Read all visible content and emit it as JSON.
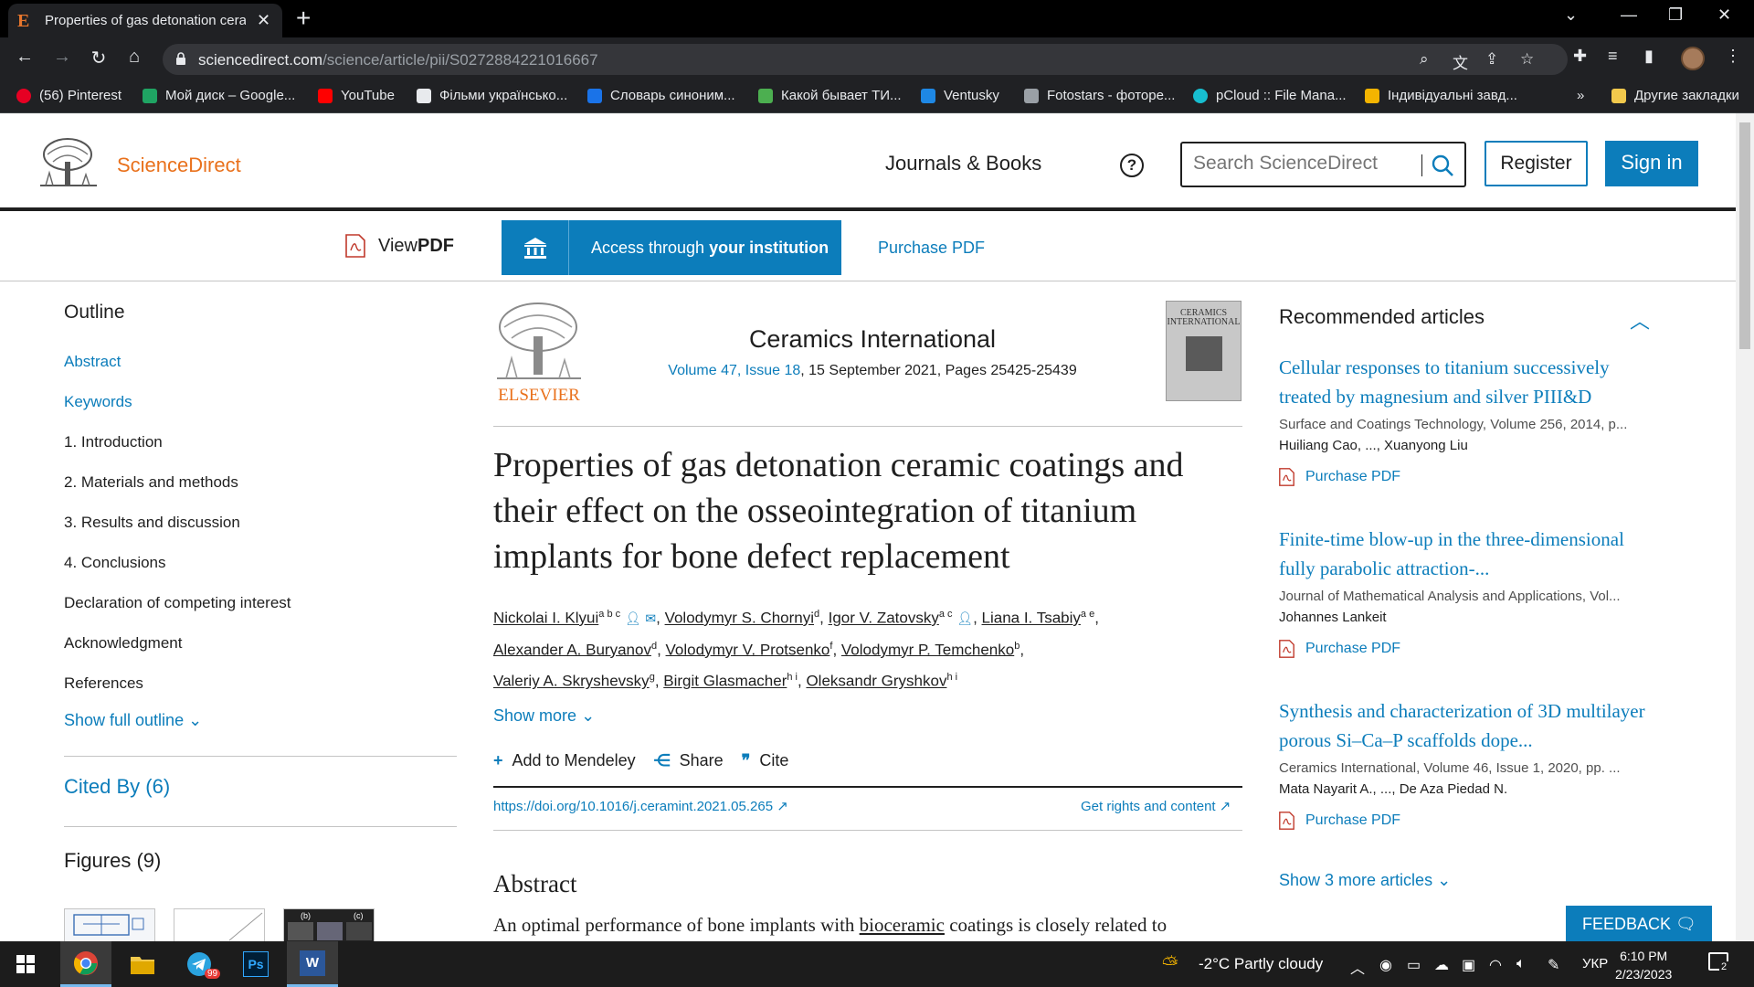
{
  "browser": {
    "tab_title": "Properties of gas detonation cera",
    "tab_favicon": "E",
    "url_domain": "sciencedirect.com",
    "url_path": "/science/article/pii/S0272884221016667",
    "bookmarks": [
      {
        "label": "(56) Pinterest",
        "color": "#e60023"
      },
      {
        "label": "Мой диск – Google...",
        "color": "#1fa463"
      },
      {
        "label": "YouTube",
        "color": "#ff0000"
      },
      {
        "label": "Фільми українсько...",
        "color": "#e8eaed"
      },
      {
        "label": "Словарь синоним...",
        "color": "#1a73e8"
      },
      {
        "label": "Какой бывает ТИ...",
        "color": "#4caf50"
      },
      {
        "label": "Ventusky",
        "color": "#1e88e5"
      },
      {
        "label": "Fotostars - фоторе...",
        "color": "#9aa0a6"
      },
      {
        "label": "pCloud :: File Mana...",
        "color": "#17bed0"
      },
      {
        "label": "Індивідуальні завд...",
        "color": "#f4b400"
      }
    ],
    "bookmarks_more": "»",
    "other_bookmarks": "Другие закладки"
  },
  "site": {
    "logo_text": "ScienceDirect",
    "nav_journals": "Journals & Books",
    "help": "?",
    "search_placeholder": "Search ScienceDirect",
    "register": "Register",
    "signin": "Sign in",
    "brand_color": "#0c7dbb",
    "logo_color": "#e9711c"
  },
  "toolbar": {
    "view_pdf_prefix": "View ",
    "view_pdf_bold": "PDF",
    "access_prefix": "Access through ",
    "access_bold": "your institution",
    "purchase_pdf": "Purchase PDF"
  },
  "outline": {
    "heading": "Outline",
    "items": [
      {
        "label": "Abstract",
        "link": true
      },
      {
        "label": "Keywords",
        "link": true
      },
      {
        "label": "1. Introduction",
        "link": false
      },
      {
        "label": "2. Materials and methods",
        "link": false
      },
      {
        "label": "3. Results and discussion",
        "link": false
      },
      {
        "label": "4. Conclusions",
        "link": false
      },
      {
        "label": "Declaration of competing interest",
        "link": false
      },
      {
        "label": "Acknowledgment",
        "link": false
      },
      {
        "label": "References",
        "link": false
      }
    ],
    "show_full": "Show full outline",
    "cited_by": "Cited By (6)",
    "figures": "Figures (9)"
  },
  "article": {
    "publisher": "ELSEVIER",
    "journal": "Ceramics International",
    "volume_link": "Volume 47, Issue 18",
    "date_pages": ", 15 September 2021, Pages 25425-25439",
    "cover_title": "CERAMICS INTERNATIONAL",
    "title": "Properties of gas detonation ceramic coatings and their effect on the osseointegration of titanium implants for bone defect replacement",
    "authors": [
      {
        "name": "Nickolai I. Klyui",
        "sup": "a b c",
        "icons": "person-mail",
        "sep": ", "
      },
      {
        "name": "Volodymyr S. Chornyi",
        "sup": "d",
        "icons": "",
        "sep": ", "
      },
      {
        "name": "Igor V. Zatovsky",
        "sup": "a c",
        "icons": "person",
        "sep": ", "
      },
      {
        "name": "Liana I. Tsabiy",
        "sup": "a e",
        "icons": "",
        "sep": ","
      },
      {
        "name": "Alexander A. Buryanov",
        "sup": "d",
        "icons": "",
        "sep": ", "
      },
      {
        "name": "Volodymyr V. Protsenko",
        "sup": "f",
        "icons": "",
        "sep": ", "
      },
      {
        "name": "Volodymyr P. Temchenko",
        "sup": "b",
        "icons": "",
        "sep": ","
      },
      {
        "name": "Valeriy A. Skryshevsky",
        "sup": "g",
        "icons": "",
        "sep": ", "
      },
      {
        "name": "Birgit Glasmacher",
        "sup": "h i",
        "icons": "",
        "sep": ", "
      },
      {
        "name": "Oleksandr Gryshkov",
        "sup": "h i",
        "icons": "",
        "sep": ""
      }
    ],
    "show_more": "Show more",
    "add_mendeley": "Add to Mendeley",
    "share": "Share",
    "cite": "Cite",
    "doi": "https://doi.org/10.1016/j.ceramint.2021.05.265",
    "rights": "Get rights and content",
    "abstract_heading": "Abstract",
    "abstract_start": "An optimal performance of bone implants with ",
    "abstract_link": "bioceramic",
    "abstract_end": " coatings is closely related to"
  },
  "recommended": {
    "heading": "Recommended articles",
    "items": [
      {
        "title": "Cellular responses to titanium successively treated by magnesium and silver PIII&D",
        "source": "Surface and Coatings Technology, Volume 256, 2014, p...",
        "authors": "Huiliang Cao, ..., Xuanyong Liu",
        "action": "Purchase PDF"
      },
      {
        "title": "Finite-time blow-up in the three-dimensional fully parabolic attraction-...",
        "source": "Journal of Mathematical Analysis and Applications, Vol...",
        "authors": "Johannes Lankeit",
        "action": "Purchase PDF"
      },
      {
        "title": "Synthesis and characterization of 3D multilayer porous Si–Ca–P scaffolds dope...",
        "source": "Ceramics International, Volume 46, Issue 1, 2020, pp. ...",
        "authors": "Mata Nayarit A., ..., De Aza Piedad N.",
        "action": "Purchase PDF"
      }
    ],
    "show_more": "Show 3 more articles",
    "feedback": "FEEDBACK"
  },
  "taskbar": {
    "telegram_badge": "99",
    "weather": "-2°C  Partly cloudy",
    "lang": "УКР",
    "time": "6:10 PM",
    "date": "2/23/2023",
    "notifications": "2"
  }
}
